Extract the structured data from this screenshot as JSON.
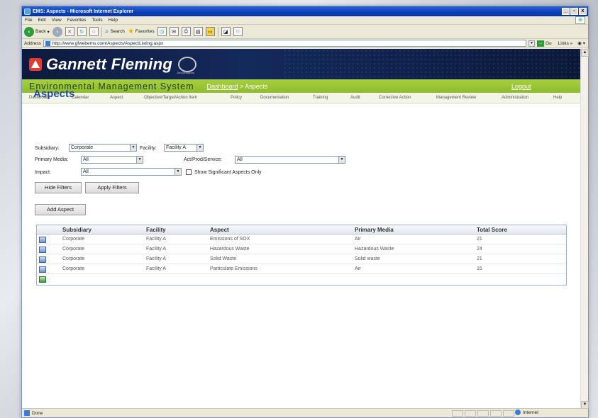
{
  "window": {
    "title": "EMS: Aspects - Microsoft Internet Explorer"
  },
  "menu": [
    "File",
    "Edit",
    "View",
    "Favorites",
    "Tools",
    "Help"
  ],
  "toolbar": {
    "back": "Back",
    "search": "Search",
    "favorites": "Favorites"
  },
  "address": {
    "label": "Address",
    "url": "http://www.gfwebems.com/Aspects/AspectListing.aspx",
    "go": "Go",
    "links": "Links"
  },
  "banner": {
    "brand": "Gannett Fleming",
    "sub_brand": "GeoDecisions"
  },
  "greenbar": {
    "system": "Environmental Management System",
    "crumb_link": "Dashboard",
    "crumb_sep": " > ",
    "crumb_current": "Aspects",
    "logout": "Logout"
  },
  "nav": [
    "Dashboard",
    "Calendar",
    "Aspect",
    "Objective/Target/Action Item",
    "Policy",
    "Documentation",
    "Training",
    "Audit",
    "Corrective Action",
    "Management Review",
    "Administration",
    "Help"
  ],
  "page": {
    "title": "Aspects",
    "filters": {
      "subsidiary_label": "Subsidiary:",
      "subsidiary_value": "Corporate",
      "facility_label": "Facility:",
      "facility_value": "Facility A",
      "primary_media_label": "Primary Media:",
      "primary_media_value": "All",
      "act_label": "Act/Prod/Service:",
      "act_value": "All",
      "impact_label": "Impact:",
      "impact_value": "All",
      "significant_label": "Show Significant Aspects Only"
    },
    "buttons": {
      "hide_filters": "Hide Filters",
      "apply_filters": "Apply Filters",
      "add_aspect": "Add Aspect"
    },
    "table": {
      "headers": [
        "Subsidiary",
        "Facility",
        "Aspect",
        "Primary Media",
        "Total Score"
      ],
      "rows": [
        [
          "Corporate",
          "Facility A",
          "Emissions of SOX",
          "Air",
          "21"
        ],
        [
          "Corporate",
          "Facility A",
          "Hazardous Waste",
          "Hazardous Waste",
          "24"
        ],
        [
          "Corporate",
          "Facility A",
          "Solid Waste",
          "Solid waste",
          "21"
        ],
        [
          "Corporate",
          "Facility A",
          "Particulate Emissions",
          "Air",
          "15"
        ]
      ]
    }
  },
  "status": {
    "left": "Done",
    "zone": "Internet"
  }
}
